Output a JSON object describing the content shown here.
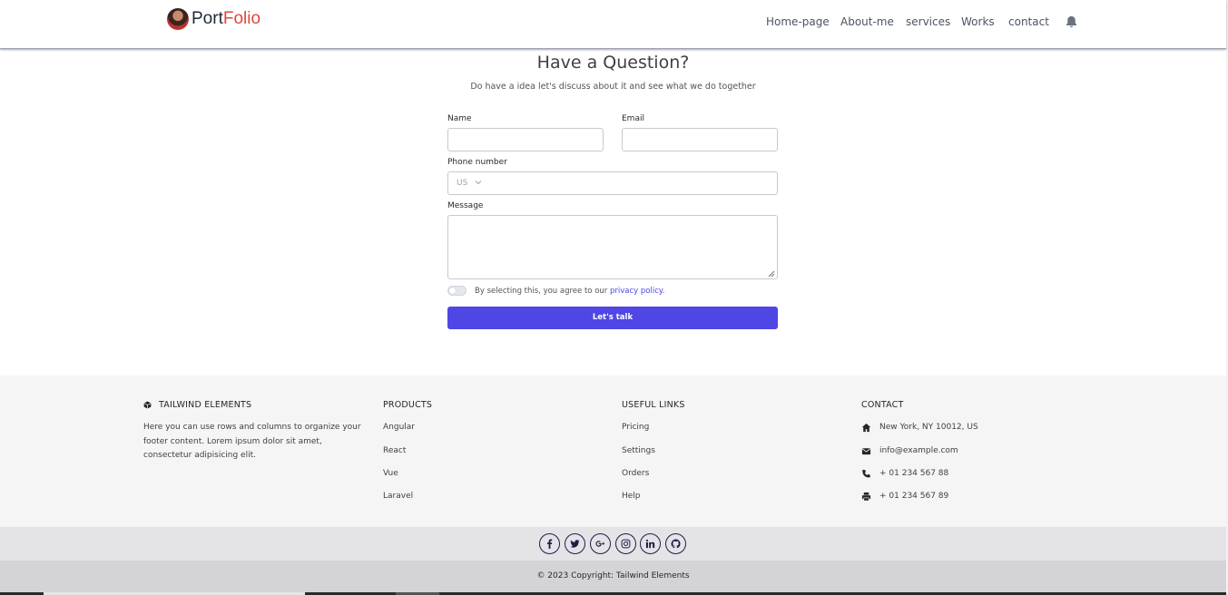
{
  "header": {
    "logo_part1": "Port",
    "logo_part2": "Folio",
    "nav": [
      "Home-page",
      "About-me",
      "services",
      "Works",
      "contact"
    ]
  },
  "form": {
    "title": "Have a Question?",
    "subtitle": "Do have a idea let's discuss about it and see what we do together",
    "name_label": "Name",
    "email_label": "Email",
    "phone_label": "Phone number",
    "country_code": "US",
    "message_label": "Message",
    "agree_text": "By selecting this, you agree to our",
    "privacy_link": "privacy policy.",
    "submit_label": "Let's talk",
    "accent_color": "#4f46e5"
  },
  "footer": {
    "brand": "TAILWIND ELEMENTS",
    "brand_text": "Here you can use rows and columns to organize your footer content. Lorem ipsum dolor sit amet, consectetur adipisicing elit.",
    "products_title": "PRODUCTS",
    "products": [
      "Angular",
      "React",
      "Vue",
      "Laravel"
    ],
    "links_title": "USEFUL LINKS",
    "links": [
      "Pricing",
      "Settings",
      "Orders",
      "Help"
    ],
    "contact_title": "CONTACT",
    "contact": {
      "address": "New York, NY 10012, US",
      "email": "info@example.com",
      "phone": "+ 01 234 567 88",
      "fax": "+ 01 234 567 89"
    },
    "social": [
      "facebook-icon",
      "twitter-icon",
      "google-plus-icon",
      "instagram-icon",
      "linkedin-icon",
      "github-icon"
    ],
    "copyright": "© 2023 Copyright: Tailwind Elements"
  }
}
